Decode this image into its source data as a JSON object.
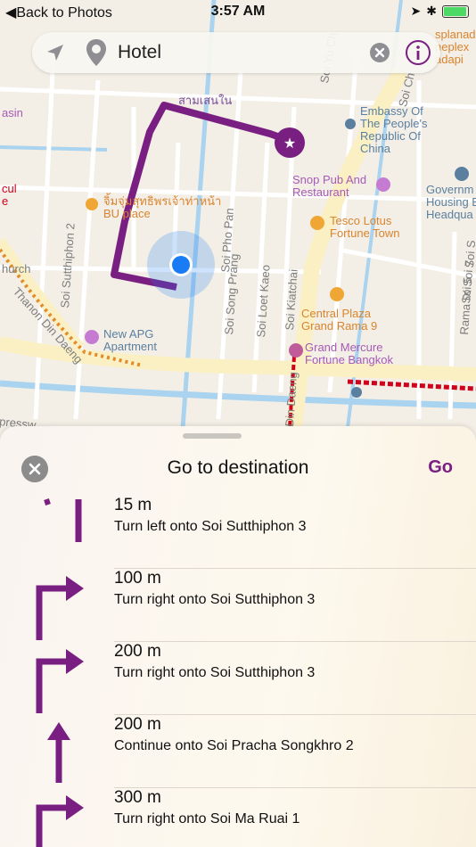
{
  "status_bar": {
    "back_label": "Back to Photos",
    "time": "3:57 AM",
    "battery_level": 0.9
  },
  "search": {
    "value": "Hotel"
  },
  "map": {
    "labels": {
      "thai_district": "สามเสนใน",
      "embassy": "Embassy Of\nThe People's\nRepublic Of\nChina",
      "snop_pub": "Snop Pub And\nRestaurant",
      "government_housing": "Governm\nHousing B\nHeadqua",
      "tesco": "Tesco Lotus\nFortune Town",
      "thai_place": "จิ้มจุ่มสุทธิพรเจ้าท่าหน้า\nBU place",
      "central_plaza": "Central Plaza\nGrand Rama 9",
      "grand_mercure": "Grand Mercure\nFortune Bangkok",
      "new_apg": "New APG\nApartment",
      "esplanade": "splanad\nneplex\nadapi",
      "asin": "asin",
      "cul": "cul\ne",
      "church": "hurch"
    },
    "roads": {
      "soi_yu_ch": "Soi Yu Ch",
      "soi_sutthiphon_2": "Soi Sutthiphon 2",
      "soi_pho_pan": "Soi Pho Pan",
      "soi_song_prang": "Soi Song Prang",
      "soi_loet_kaeo": "Soi Loet Kaeo",
      "soi_kiatchai": "Soi Kiatchai",
      "thanon_din_daeng": "Thanon Din Daeng",
      "din_daeng": "Din Daeng",
      "soi_s": "Soi S",
      "rama_ix_soi_7": "Rama IX Soi 7",
      "soi_5": "Soi 5",
      "soi_ch": "Soi Ch",
      "press": "pressw"
    },
    "colors": {
      "route": "#7a1f82",
      "location_dot": "#1a7cf5",
      "traffic": "#d0021b",
      "main_road": "#fbf0c4"
    }
  },
  "sheet": {
    "title": "Go to destination",
    "go_label": "Go"
  },
  "directions": [
    {
      "distance": "15 m",
      "instruction": "Turn left onto Soi Sutthiphon 3",
      "icon": "straight-partial-icon"
    },
    {
      "distance": "100 m",
      "instruction": "Turn right onto Soi Sutthiphon 3",
      "icon": "turn-right-icon"
    },
    {
      "distance": "200 m",
      "instruction": "Turn right onto Soi Sutthiphon 3",
      "icon": "turn-right-icon"
    },
    {
      "distance": "200 m",
      "instruction": "Continue onto Soi Pracha Songkhro 2",
      "icon": "straight-arrow-icon"
    },
    {
      "distance": "300 m",
      "instruction": "Turn right onto Soi Ma Ruai 1",
      "icon": "turn-right-icon"
    }
  ]
}
